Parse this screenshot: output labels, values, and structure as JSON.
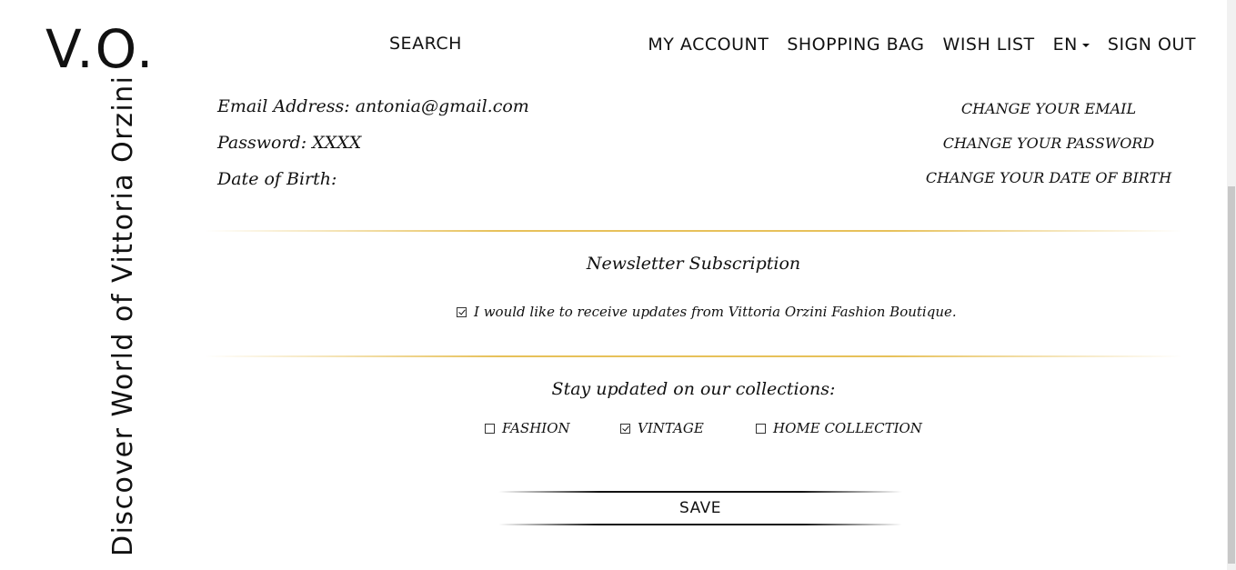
{
  "logo": "V.O.",
  "side_text": "Discover World of Vittoria Orzini",
  "nav": {
    "search": "SEARCH",
    "my_account": "MY ACCOUNT",
    "shopping_bag": "SHOPPING BAG",
    "wish_list": "WISH LIST",
    "language": "EN",
    "sign_out": "SIGN OUT"
  },
  "account": {
    "email": "Email Address: antonia@gmail.com",
    "password": "Password: XXXX",
    "dob": "Date of Birth:",
    "change_email": "CHANGE YOUR EMAIL",
    "change_password": "CHANGE YOUR PASSWORD",
    "change_dob": "CHANGE YOUR DATE OF BIRTH"
  },
  "newsletter": {
    "title": "Newsletter Subscription",
    "label": "I would like to receive updates from Vittoria Orzini Fashion Boutique.",
    "checked": true
  },
  "collections": {
    "title": "Stay updated on our collections:",
    "items": [
      {
        "label": "FASHION",
        "checked": false
      },
      {
        "label": "VINTAGE",
        "checked": true
      },
      {
        "label": "HOME COLLECTION",
        "checked": false
      }
    ]
  },
  "save_label": "SAVE"
}
